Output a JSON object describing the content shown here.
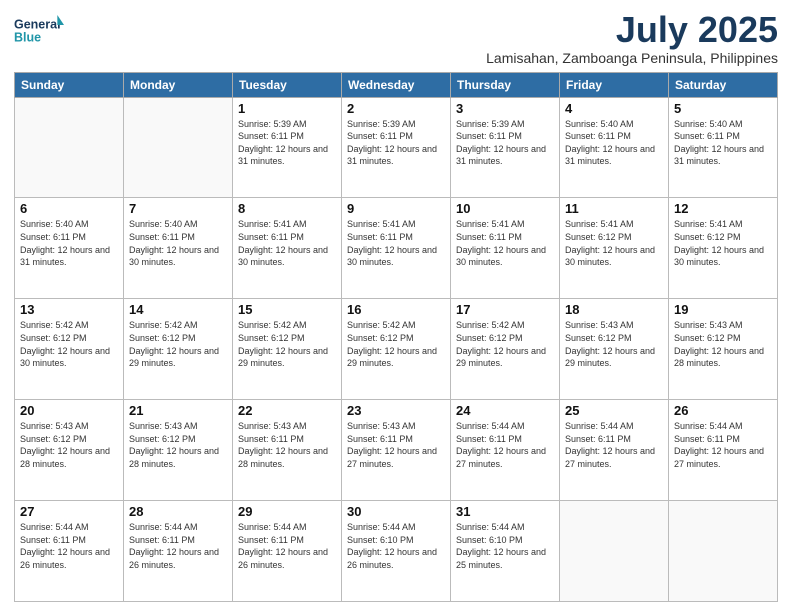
{
  "logo": {
    "line1": "General",
    "line2": "Blue"
  },
  "title": "July 2025",
  "location": "Lamisahan, Zamboanga Peninsula, Philippines",
  "days_of_week": [
    "Sunday",
    "Monday",
    "Tuesday",
    "Wednesday",
    "Thursday",
    "Friday",
    "Saturday"
  ],
  "weeks": [
    [
      {
        "day": "",
        "info": ""
      },
      {
        "day": "",
        "info": ""
      },
      {
        "day": "1",
        "info": "Sunrise: 5:39 AM\nSunset: 6:11 PM\nDaylight: 12 hours and 31 minutes."
      },
      {
        "day": "2",
        "info": "Sunrise: 5:39 AM\nSunset: 6:11 PM\nDaylight: 12 hours and 31 minutes."
      },
      {
        "day": "3",
        "info": "Sunrise: 5:39 AM\nSunset: 6:11 PM\nDaylight: 12 hours and 31 minutes."
      },
      {
        "day": "4",
        "info": "Sunrise: 5:40 AM\nSunset: 6:11 PM\nDaylight: 12 hours and 31 minutes."
      },
      {
        "day": "5",
        "info": "Sunrise: 5:40 AM\nSunset: 6:11 PM\nDaylight: 12 hours and 31 minutes."
      }
    ],
    [
      {
        "day": "6",
        "info": "Sunrise: 5:40 AM\nSunset: 6:11 PM\nDaylight: 12 hours and 31 minutes."
      },
      {
        "day": "7",
        "info": "Sunrise: 5:40 AM\nSunset: 6:11 PM\nDaylight: 12 hours and 30 minutes."
      },
      {
        "day": "8",
        "info": "Sunrise: 5:41 AM\nSunset: 6:11 PM\nDaylight: 12 hours and 30 minutes."
      },
      {
        "day": "9",
        "info": "Sunrise: 5:41 AM\nSunset: 6:11 PM\nDaylight: 12 hours and 30 minutes."
      },
      {
        "day": "10",
        "info": "Sunrise: 5:41 AM\nSunset: 6:11 PM\nDaylight: 12 hours and 30 minutes."
      },
      {
        "day": "11",
        "info": "Sunrise: 5:41 AM\nSunset: 6:12 PM\nDaylight: 12 hours and 30 minutes."
      },
      {
        "day": "12",
        "info": "Sunrise: 5:41 AM\nSunset: 6:12 PM\nDaylight: 12 hours and 30 minutes."
      }
    ],
    [
      {
        "day": "13",
        "info": "Sunrise: 5:42 AM\nSunset: 6:12 PM\nDaylight: 12 hours and 30 minutes."
      },
      {
        "day": "14",
        "info": "Sunrise: 5:42 AM\nSunset: 6:12 PM\nDaylight: 12 hours and 29 minutes."
      },
      {
        "day": "15",
        "info": "Sunrise: 5:42 AM\nSunset: 6:12 PM\nDaylight: 12 hours and 29 minutes."
      },
      {
        "day": "16",
        "info": "Sunrise: 5:42 AM\nSunset: 6:12 PM\nDaylight: 12 hours and 29 minutes."
      },
      {
        "day": "17",
        "info": "Sunrise: 5:42 AM\nSunset: 6:12 PM\nDaylight: 12 hours and 29 minutes."
      },
      {
        "day": "18",
        "info": "Sunrise: 5:43 AM\nSunset: 6:12 PM\nDaylight: 12 hours and 29 minutes."
      },
      {
        "day": "19",
        "info": "Sunrise: 5:43 AM\nSunset: 6:12 PM\nDaylight: 12 hours and 28 minutes."
      }
    ],
    [
      {
        "day": "20",
        "info": "Sunrise: 5:43 AM\nSunset: 6:12 PM\nDaylight: 12 hours and 28 minutes."
      },
      {
        "day": "21",
        "info": "Sunrise: 5:43 AM\nSunset: 6:12 PM\nDaylight: 12 hours and 28 minutes."
      },
      {
        "day": "22",
        "info": "Sunrise: 5:43 AM\nSunset: 6:11 PM\nDaylight: 12 hours and 28 minutes."
      },
      {
        "day": "23",
        "info": "Sunrise: 5:43 AM\nSunset: 6:11 PM\nDaylight: 12 hours and 27 minutes."
      },
      {
        "day": "24",
        "info": "Sunrise: 5:44 AM\nSunset: 6:11 PM\nDaylight: 12 hours and 27 minutes."
      },
      {
        "day": "25",
        "info": "Sunrise: 5:44 AM\nSunset: 6:11 PM\nDaylight: 12 hours and 27 minutes."
      },
      {
        "day": "26",
        "info": "Sunrise: 5:44 AM\nSunset: 6:11 PM\nDaylight: 12 hours and 27 minutes."
      }
    ],
    [
      {
        "day": "27",
        "info": "Sunrise: 5:44 AM\nSunset: 6:11 PM\nDaylight: 12 hours and 26 minutes."
      },
      {
        "day": "28",
        "info": "Sunrise: 5:44 AM\nSunset: 6:11 PM\nDaylight: 12 hours and 26 minutes."
      },
      {
        "day": "29",
        "info": "Sunrise: 5:44 AM\nSunset: 6:11 PM\nDaylight: 12 hours and 26 minutes."
      },
      {
        "day": "30",
        "info": "Sunrise: 5:44 AM\nSunset: 6:10 PM\nDaylight: 12 hours and 26 minutes."
      },
      {
        "day": "31",
        "info": "Sunrise: 5:44 AM\nSunset: 6:10 PM\nDaylight: 12 hours and 25 minutes."
      },
      {
        "day": "",
        "info": ""
      },
      {
        "day": "",
        "info": ""
      }
    ]
  ]
}
